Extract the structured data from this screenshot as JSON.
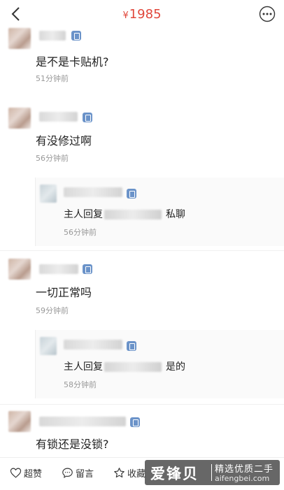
{
  "header": {
    "price_symbol": "¥",
    "price_value": "1985",
    "price_color": "#e0473b",
    "back_icon": "chevron-left-icon",
    "more_icon": "more-dots-icon"
  },
  "comments": [
    {
      "text": "是不是卡贴机?",
      "time": "51分钟前"
    },
    {
      "text": "有没修过啊",
      "time": "56分钟前",
      "reply": {
        "prefix": "主人回复",
        "suffix": "私聊",
        "time": "56分钟前"
      }
    },
    {
      "text": "一切正常吗",
      "time": "59分钟前",
      "reply": {
        "prefix": "主人回复",
        "suffix": "是的",
        "time": "58分钟前"
      }
    },
    {
      "text": "有锁还是没锁?"
    }
  ],
  "bottom_bar": {
    "like_label": "超赞",
    "comment_label": "留言",
    "favorite_label": "收藏"
  },
  "watermark": {
    "brand": "爱锋贝",
    "tagline": "精选优质二手",
    "url": "aifengbei.com"
  }
}
